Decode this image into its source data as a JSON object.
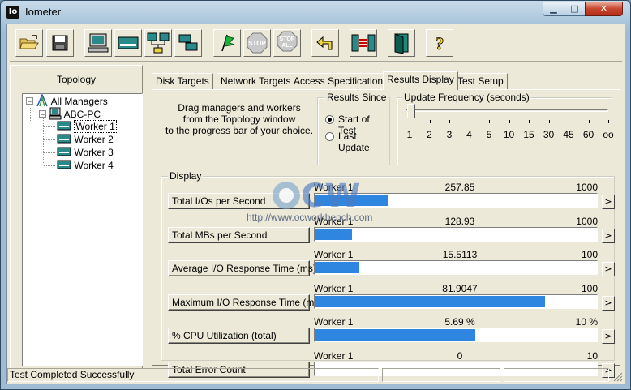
{
  "window": {
    "title": "Iometer",
    "app_icon_text": "Io"
  },
  "toolbar": {
    "buttons": [
      {
        "icon": "open-folder-icon"
      },
      {
        "icon": "save-disk-icon"
      },
      {
        "icon": "new-manager-icon"
      },
      {
        "icon": "new-disk-worker-icon"
      },
      {
        "icon": "new-network-worker-icon"
      },
      {
        "icon": "duplicate-worker-icon"
      },
      {
        "icon": "start-flag-icon"
      },
      {
        "icon": "stop-icon",
        "label": "STOP"
      },
      {
        "icon": "stop-all-icon",
        "label": "STOP ALL"
      },
      {
        "icon": "reset-workers-icon"
      },
      {
        "icon": "exit-icon"
      },
      {
        "icon": "about-icon"
      }
    ]
  },
  "topology": {
    "title": "Topology",
    "root": "All Managers",
    "manager": "ABC-PC",
    "workers": [
      "Worker 1",
      "Worker 2",
      "Worker 3",
      "Worker 4"
    ]
  },
  "tabs": [
    "Disk Targets",
    "Network Targets",
    "Access Specifications",
    "Results Display",
    "Test Setup"
  ],
  "active_tab": "Results Display",
  "results_display": {
    "instructions": [
      "Drag managers and workers",
      "from the Topology window",
      "to the progress bar of your choice."
    ],
    "results_since": {
      "label": "Results Since",
      "options": [
        "Start of Test",
        "Last Update"
      ],
      "selected": "Start of Test"
    },
    "update_frequency": {
      "label": "Update Frequency (seconds)",
      "ticks": [
        "1",
        "2",
        "3",
        "4",
        "5",
        "10",
        "15",
        "30",
        "45",
        "60",
        "oo"
      ],
      "selected": "1"
    },
    "display_label": "Display",
    "metrics": [
      {
        "name": "Total I/Os per Second",
        "worker": "Worker 1",
        "value": "257.85",
        "max": "1000",
        "fraction": 0.258
      },
      {
        "name": "Total MBs per Second",
        "worker": "Worker 1",
        "value": "128.93",
        "max": "1000",
        "fraction": 0.129
      },
      {
        "name": "Average I/O Response Time (ms)",
        "worker": "Worker 1",
        "value": "15.5113",
        "max": "100",
        "fraction": 0.155
      },
      {
        "name": "Maximum I/O Response Time (ms)",
        "worker": "Worker 1",
        "value": "81.9047",
        "max": "100",
        "fraction": 0.819
      },
      {
        "name": "% CPU Utilization (total)",
        "worker": "Worker 1",
        "value": "5.69 %",
        "max": "10 %",
        "fraction": 0.569
      },
      {
        "name": "Total Error Count",
        "worker": "Worker 1",
        "value": "0",
        "max": "10",
        "fraction": 0
      }
    ],
    "arrow_label": ">"
  },
  "status": {
    "text": "Test Completed Successfully"
  },
  "watermark": {
    "text": "OCW",
    "url": "http://www.ocworkbench.com"
  },
  "colors": {
    "bar_fill": "#2f86e0",
    "window_frame": "#9fbcd4",
    "dialog_bg": "#ece9d8"
  }
}
